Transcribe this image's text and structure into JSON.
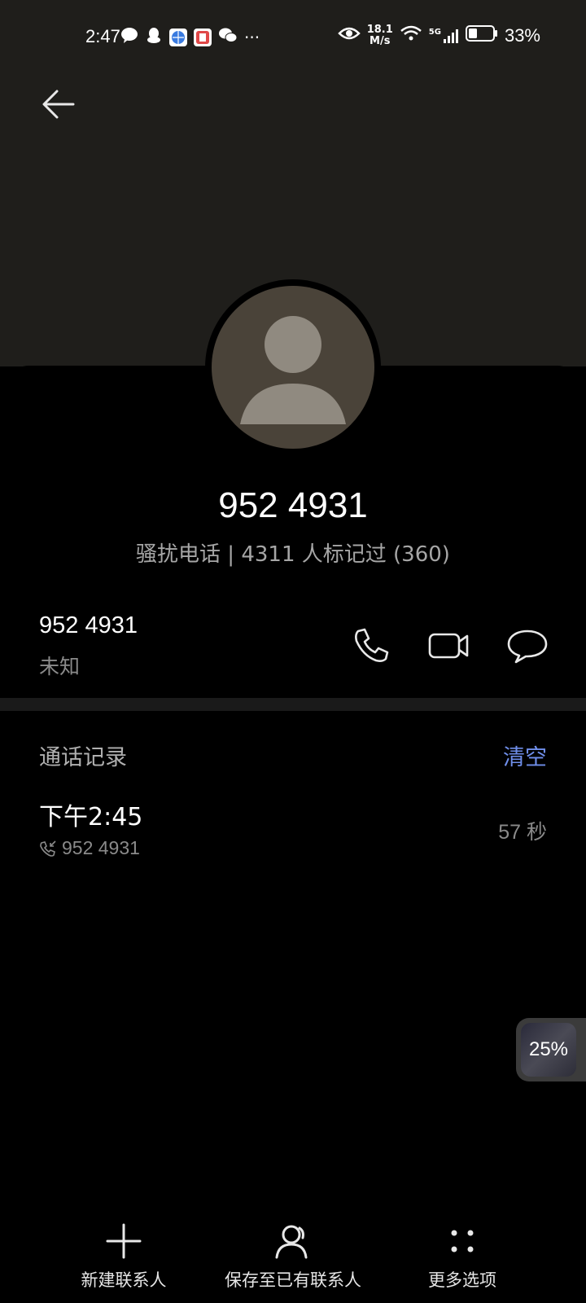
{
  "status_bar": {
    "time": "2:47",
    "net_speed_value": "18.1",
    "net_speed_unit": "M/s",
    "signal_label": "5G",
    "battery": "33%"
  },
  "contact": {
    "name": "952 4931",
    "tag": "骚扰电话 | 4311 人标记过 (360)",
    "number": "952 4931",
    "location": "未知"
  },
  "call_log": {
    "title": "通话记录",
    "clear_label": "清空",
    "entries": [
      {
        "time": "下午2:45",
        "number": "952 4931",
        "duration": "57 秒"
      }
    ]
  },
  "floating_widget": {
    "percent": "25%"
  },
  "bottom_bar": {
    "new_contact": "新建联系人",
    "save_existing": "保存至已有联系人",
    "more_options": "更多选项"
  },
  "colors": {
    "accent": "#6f8eea",
    "header_bg": "#1f1e1b",
    "avatar_bg": "#4a4339"
  }
}
